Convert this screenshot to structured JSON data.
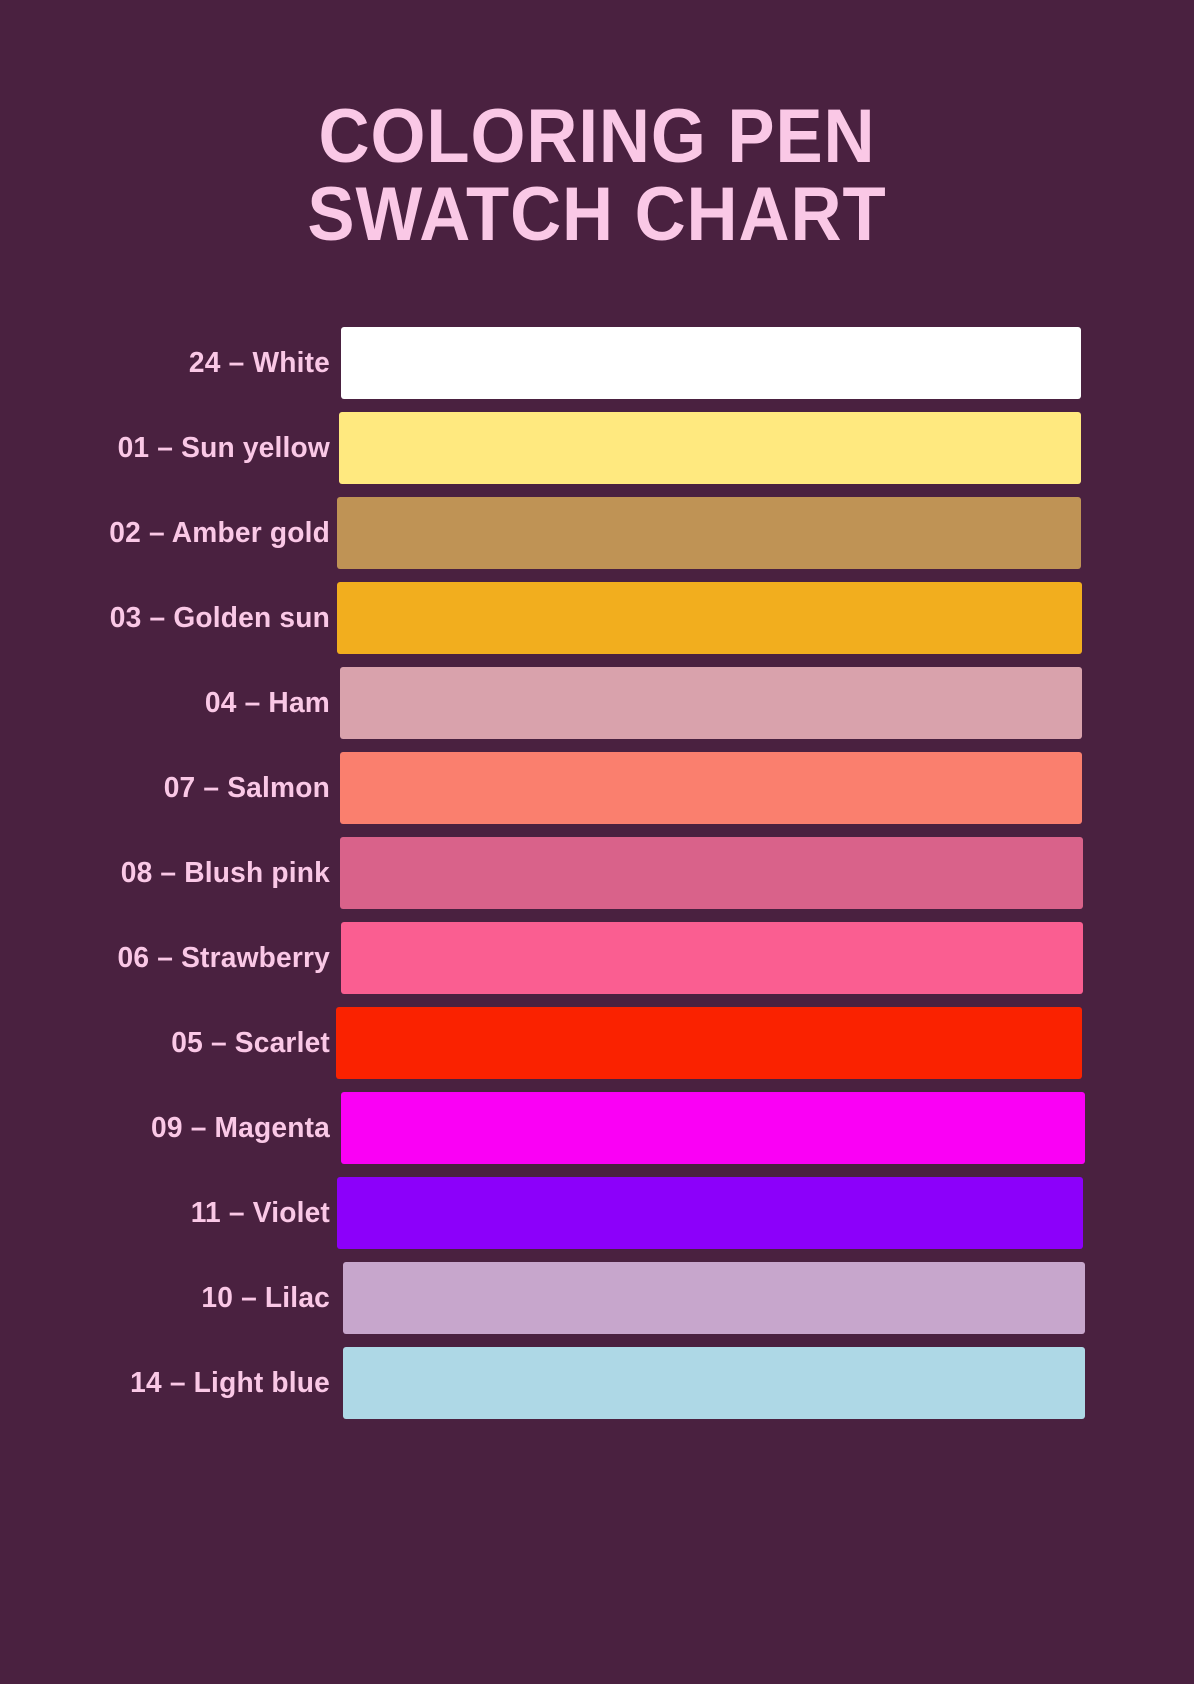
{
  "background_color": "#4A2140",
  "text_color": "#FAC8E6",
  "title": {
    "line1": "Coloring Pen",
    "line2": "Swatch Chart"
  },
  "swatches": [
    {
      "label": "24 – White",
      "code": "24",
      "name": "White",
      "color": "#FFFFFF"
    },
    {
      "label": "01 – Sun yellow",
      "code": "01",
      "name": "Sun yellow",
      "color": "#FFE97F"
    },
    {
      "label": "02 – Amber gold",
      "code": "02",
      "name": "Amber gold",
      "color": "#BF9355"
    },
    {
      "label": "03 – Golden sun",
      "code": "03",
      "name": "Golden sun",
      "color": "#F2AE1E"
    },
    {
      "label": "04 – Ham",
      "code": "04",
      "name": "Ham",
      "color": "#D9A2AC"
    },
    {
      "label": "07 – Salmon",
      "code": "07",
      "name": "Salmon",
      "color": "#FA7F6E"
    },
    {
      "label": "08 – Blush pink",
      "code": "08",
      "name": "Blush pink",
      "color": "#D9628A"
    },
    {
      "label": "06 – Strawberry",
      "code": "06",
      "name": "Strawberry",
      "color": "#FA5E91"
    },
    {
      "label": "05 – Scarlet",
      "code": "05",
      "name": "Scarlet",
      "color": "#FA2200"
    },
    {
      "label": "09 – Magenta",
      "code": "09",
      "name": "Magenta",
      "color": "#FA00F5"
    },
    {
      "label": "11 – Violet",
      "code": "11",
      "name": "Violet",
      "color": "#8C00FA"
    },
    {
      "label": "10 – Lilac",
      "code": "10",
      "name": "Lilac",
      "color": "#C7A6CC"
    },
    {
      "label": "14 – Light blue",
      "code": "14",
      "name": "Light blue",
      "color": "#AED8E6"
    }
  ]
}
